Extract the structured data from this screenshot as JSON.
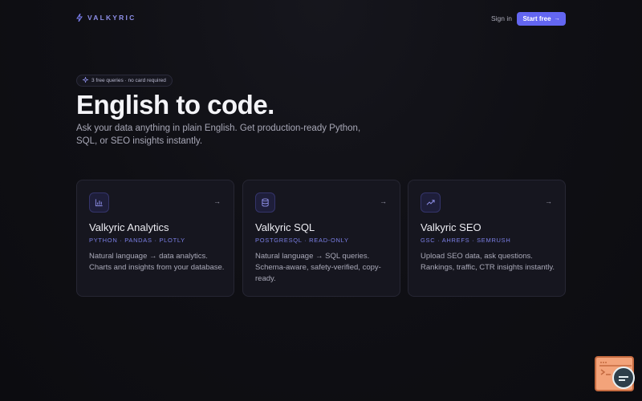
{
  "nav": {
    "brand_name": "VALKYRIC",
    "signin_label": "Sign in",
    "start_label": "Start free",
    "start_arrow": "→"
  },
  "hero": {
    "badge": "3 free queries · no card required",
    "title": "English to code.",
    "subtitle": "Ask your data anything in plain English. Get production-ready Python, SQL, or SEO insights instantly."
  },
  "cards": [
    {
      "icon": "bar-chart-icon",
      "title": "Valkyric Analytics",
      "tags": "PYTHON · PANDAS · PLOTLY",
      "description": "Natural language → data analytics. Charts and insights from your database.",
      "arrow": "→"
    },
    {
      "icon": "database-icon",
      "title": "Valkyric SQL",
      "tags": "POSTGRESQL · READ-ONLY",
      "description": "Natural language → SQL queries. Schema-aware, safety-verified, copy-ready.",
      "arrow": "→"
    },
    {
      "icon": "trending-up-icon",
      "title": "Valkyric SEO",
      "tags": "GSC · AHREFS · SEMRUSH",
      "description": "Upload SEO data, ask questions. Rankings, traffic, CTR insights instantly.",
      "arrow": "→"
    }
  ],
  "colors": {
    "accent": "#6366f1",
    "background": "#0f0f14",
    "card": "#16161f"
  }
}
